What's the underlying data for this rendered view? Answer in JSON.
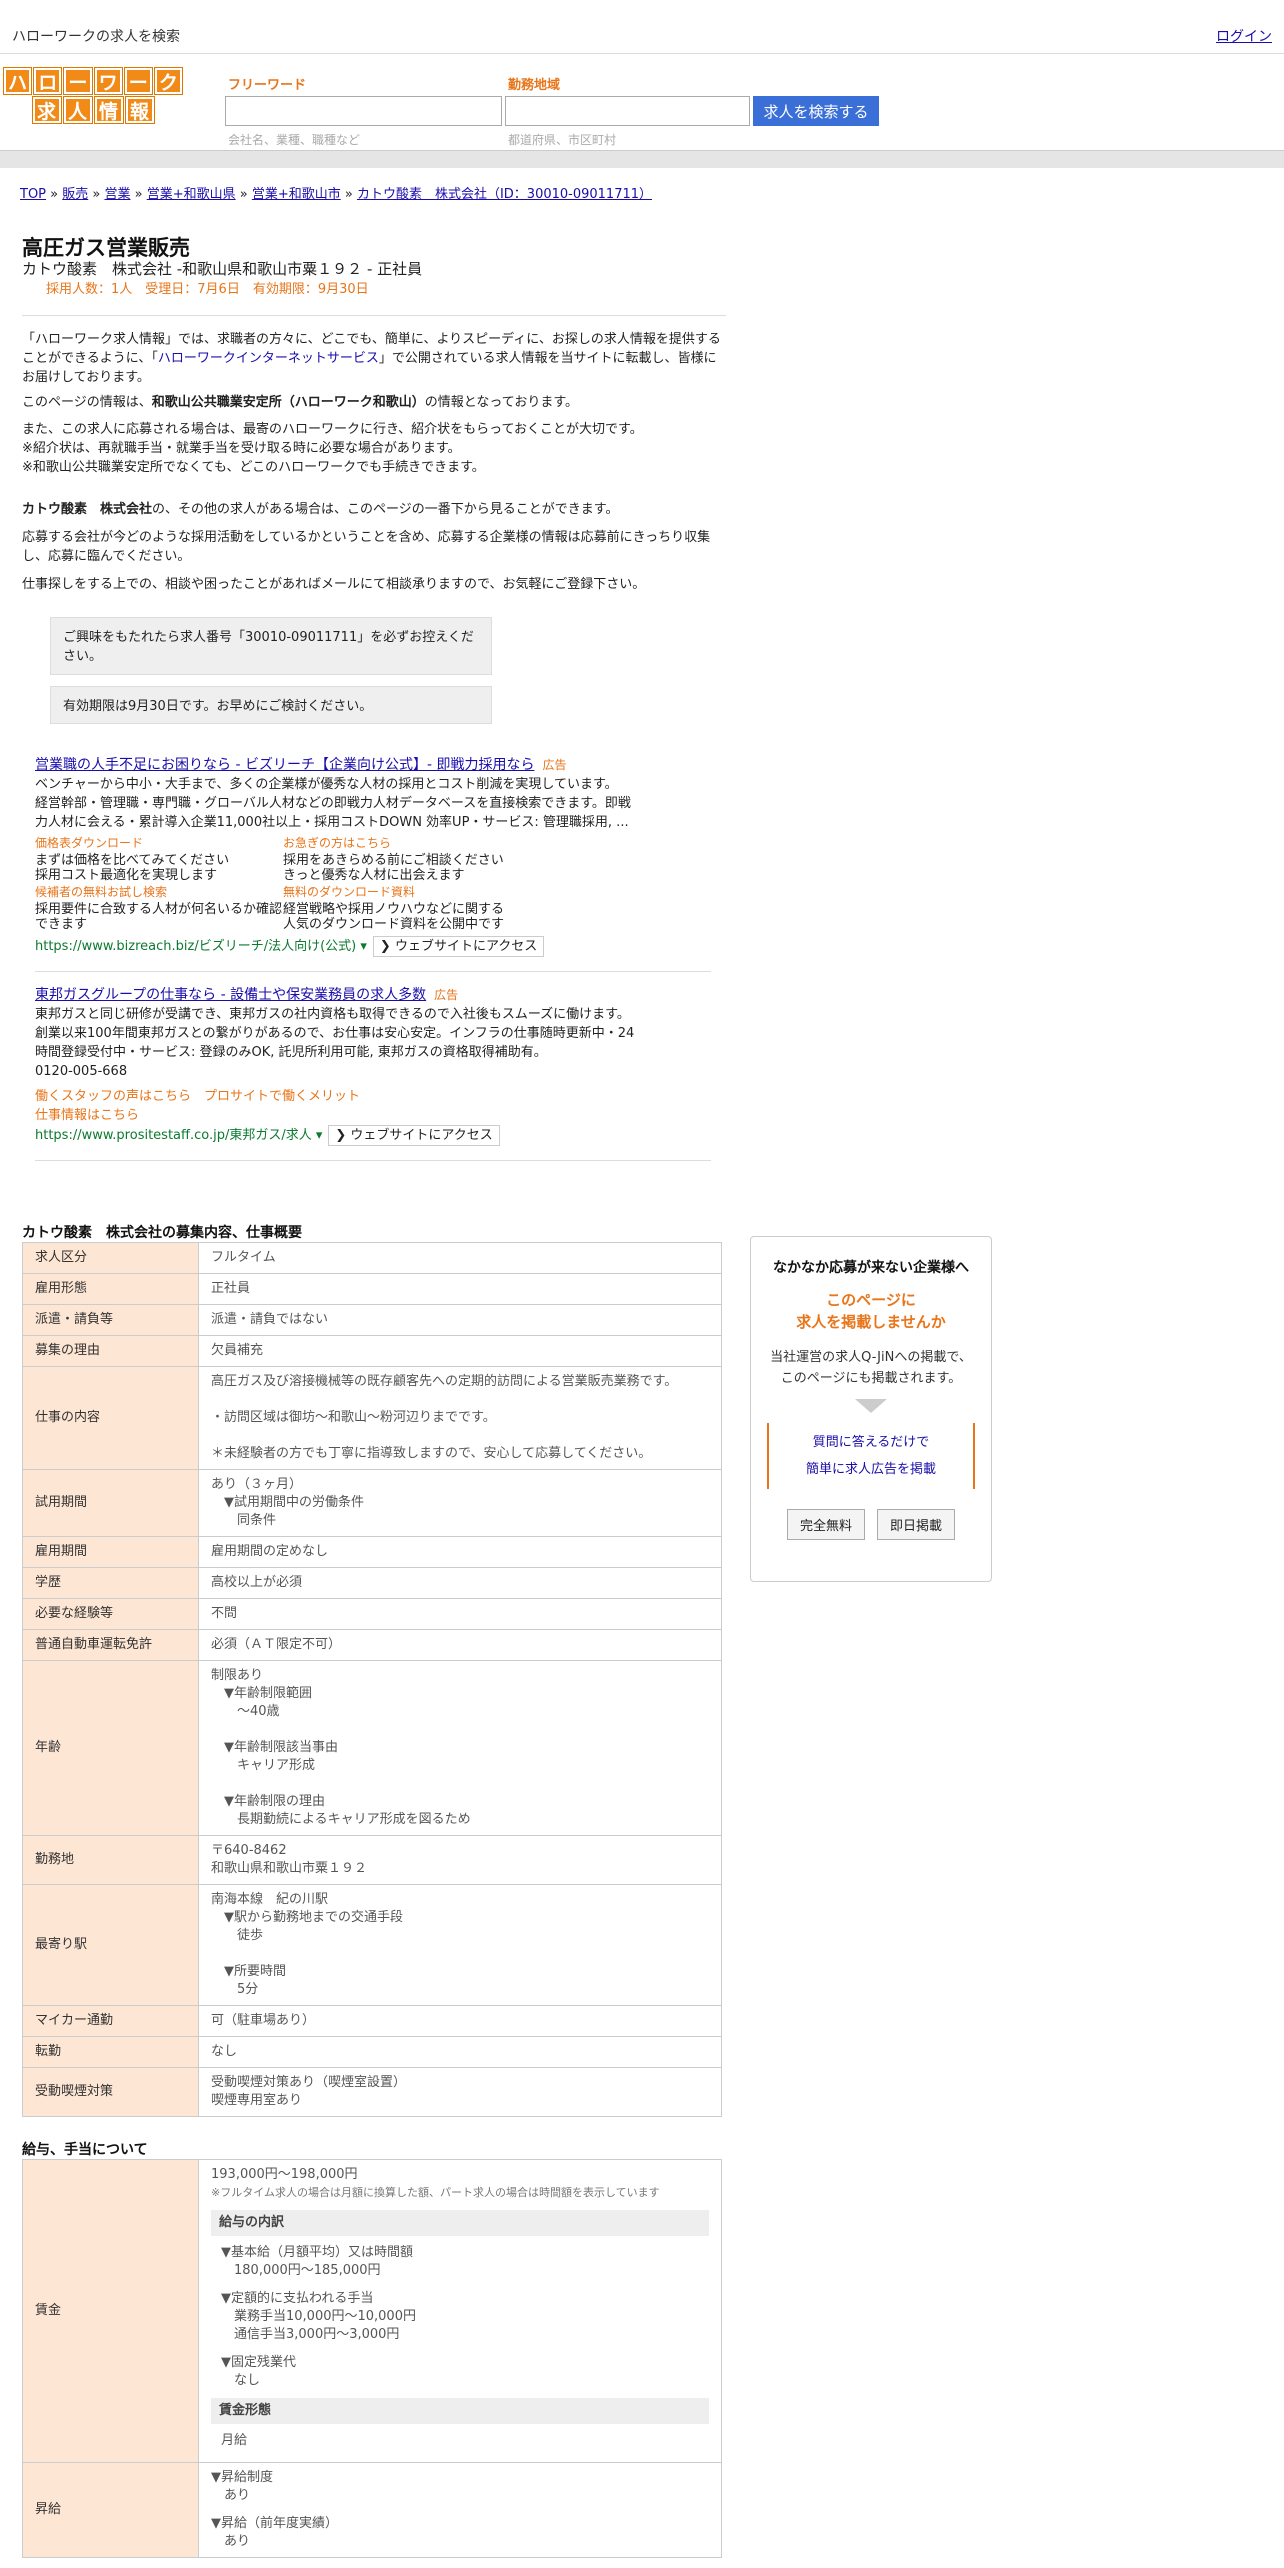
{
  "topbar": {
    "title": "ハローワークの求人を検索",
    "login": "ログイン"
  },
  "logo": {
    "row1": [
      "ハ",
      "ロ",
      "ー",
      "ワ",
      "ー",
      "ク"
    ],
    "row2": [
      "求",
      "人",
      "情",
      "報"
    ]
  },
  "search": {
    "free_label": "フリーワード",
    "free_placeholder": "会社名、業種、職種など",
    "area_label": "勤務地域",
    "area_placeholder": "都道府県、市区町村",
    "button": "求人を検索する"
  },
  "breadcrumb": [
    "TOP",
    "販売",
    "営業",
    "営業+和歌山県",
    "営業+和歌山市",
    "カトウ酸素　株式会社（ID：30010-09011711）"
  ],
  "job": {
    "title": "高圧ガス営業販売",
    "subtitle": "カトウ酸素　株式会社 -和歌山県和歌山市粟１９２ - 正社員",
    "meta": "採用人数：1人　受理日：7月6日　有効期限：9月30日"
  },
  "intro": {
    "p1a": "「ハローワーク求人情報」では、求職者の方々に、どこでも、簡単に、よりスピーディに、お探しの求人情報を提供することができるように、「",
    "p1link": "ハローワークインターネットサービス",
    "p1b": "」で公開されている求人情報を当サイトに転載し、皆様にお届けしております。",
    "p2a": "このページの情報は、",
    "p2b": "和歌山公共職業安定所（ハローワーク和歌山）",
    "p2c": "の情報となっております。",
    "p3": "また、この求人に応募される場合は、最寄のハローワークに行き、紹介状をもらっておくことが大切です。",
    "p4": "※紹介状は、再就職手当・就業手当を受け取る時に必要な場合があります。",
    "p5": "※和歌山公共職業安定所でなくても、どこのハローワークでも手続きできます。",
    "p6a": "カトウ酸素　株式会社",
    "p6b": "の、その他の求人がある場合は、このページの一番下から見ることができます。",
    "p7": "応募する会社が今どのような採用活動をしているかということを含め、応募する企業様の情報は応募前にきっちり収集し、応募に臨んでください。",
    "p8": "仕事探しをする上での、相談や困ったことがあればメールにて相談承りますので、お気軽にご登録下さい。"
  },
  "notice": {
    "n1": "ご興味をもたれたら求人番号「30010-09011711」を必ずお控えください。",
    "n2": "有効期限は9月30日です。お早めにご検討ください。"
  },
  "ad1": {
    "title": "営業職の人手不足にお困りなら - ビズリーチ【企業向け公式】- 即戦力採用なら",
    "tag": "広告",
    "l1": "ベンチャーから中小・大手まで、多くの企業様が優秀な人材の採用とコスト削減を実現しています。",
    "l2": "経営幹部・管理職・専門職・グローバル人材などの即戦力人材データベースを直接検索できます。即戦力人材に会える・累計導入企業11,000社以上・採用コストDOWN 効率UP・サービス: 管理職採用, ...",
    "links": [
      {
        "k": "価格表ダウンロード",
        "v": "まずは価格を比べてみてください\n採用コスト最適化を実現します"
      },
      {
        "k": "お急ぎの方はこちら",
        "v": "採用をあきらめる前にご相談ください\nきっと優秀な人材に出会えます"
      },
      {
        "k": "候補者の無料お試し検索",
        "v": "採用要件に合致する人材が何名いるか確認できます"
      },
      {
        "k": "無料のダウンロード資料",
        "v": "経営戦略や採用ノウハウなどに関する\n人気のダウンロード資料を公開中です"
      }
    ],
    "url": "https://www.bizreach.biz/ビズリーチ/法人向け(公式) ▾",
    "btn": "❯ ウェブサイトにアクセス"
  },
  "ad2": {
    "title": "東邦ガスグループの仕事なら - 設備士や保安業務員の求人多数",
    "tag": "広告",
    "l1": "東邦ガスと同じ研修が受講でき、東邦ガスの社内資格も取得できるので入社後もスムーズに働けます。",
    "l2": "創業以来100年間東邦ガスとの繋がりがあるので、お仕事は安心安定。インフラの仕事随時更新中・24時間登録受付中・サービス: 登録のみOK, 託児所利用可能, 東邦ガスの資格取得補助有。",
    "tel": "0120-005-668",
    "o1": "働くスタッフの声はこちら　プロサイトで働くメリット",
    "o2": "仕事情報はこちら",
    "url": "https://www.prositestaff.co.jp/東邦ガス/求人 ▾",
    "btn": "❯ ウェブサイトにアクセス"
  },
  "section1": "カトウ酸素　株式会社の募集内容、仕事概要",
  "rows": [
    {
      "k": "求人区分",
      "v": "フルタイム"
    },
    {
      "k": "雇用形態",
      "v": "正社員"
    },
    {
      "k": "派遣・請負等",
      "v": "派遣・請負ではない"
    },
    {
      "k": "募集の理由",
      "v": "欠員補充"
    },
    {
      "k": "仕事の内容",
      "v": "高圧ガス及び溶接機械等の既存顧客先への定期的訪問による営業販売業務です。\n\n・訪問区域は御坊～和歌山～粉河辺りまでです。\n\n＊未経験者の方でも丁寧に指導致しますので、安心して応募してください。"
    },
    {
      "k": "試用期間",
      "v": "あり（３ヶ月）\n　▼試用期間中の労働条件\n　　同条件"
    },
    {
      "k": "雇用期間",
      "v": "雇用期間の定めなし"
    },
    {
      "k": "学歴",
      "v": "高校以上が必須"
    },
    {
      "k": "必要な経験等",
      "v": "不問"
    },
    {
      "k": "普通自動車運転免許",
      "v": "必須（ＡＴ限定不可）"
    },
    {
      "k": "年齢",
      "v": "制限あり\n　▼年齢制限範囲\n　　〜40歳\n\n　▼年齢制限該当事由\n　　キャリア形成\n\n　▼年齢制限の理由\n　　長期勤続によるキャリア形成を図るため"
    },
    {
      "k": "勤務地",
      "v": "〒640-8462\n和歌山県和歌山市粟１９２"
    },
    {
      "k": "最寄り駅",
      "v": "南海本線　紀の川駅\n　▼駅から勤務地までの交通手段\n　　徒歩\n\n　▼所要時間\n　　5分"
    },
    {
      "k": "マイカー通勤",
      "v": "可（駐車場あり）"
    },
    {
      "k": "転勤",
      "v": "なし"
    },
    {
      "k": "受動喫煙対策",
      "v": "受動喫煙対策あり（喫煙室設置）\n喫煙専用室あり"
    }
  ],
  "section2": "給与、手当について",
  "wage": {
    "k": "賃金",
    "range": "193,000円〜198,000円",
    "note": "※フルタイム求人の場合は月額に換算した額、パート求人の場合は時間額を表示しています",
    "h1": "給与の内訳",
    "b1": "▼基本給（月額平均）又は時間額\n　180,000円〜185,000円",
    "b2": "▼定額的に支払われる手当\n　業務手当10,000円〜10,000円\n　通信手当3,000円〜3,000円",
    "b3": "▼固定残業代\n　なし",
    "h2": "賃金形態",
    "b4": "月給"
  },
  "raise": {
    "k": "昇給",
    "b1": "▼昇給制度\n　あり",
    "b2": "▼昇給（前年度実績）\n　あり"
  },
  "side": {
    "t1": "なかなか応募が来ない企業様へ",
    "t2a": "このページに",
    "t2b": "求人を掲載しませんか",
    "t3a": "当社運営の求人Q-JiNへの掲載で、",
    "t3b": "このページにも掲載されます。",
    "l1": "質問に答えるだけで",
    "l2": "簡単に求人広告を掲載",
    "b1": "完全無料",
    "b2": "即日掲載"
  }
}
